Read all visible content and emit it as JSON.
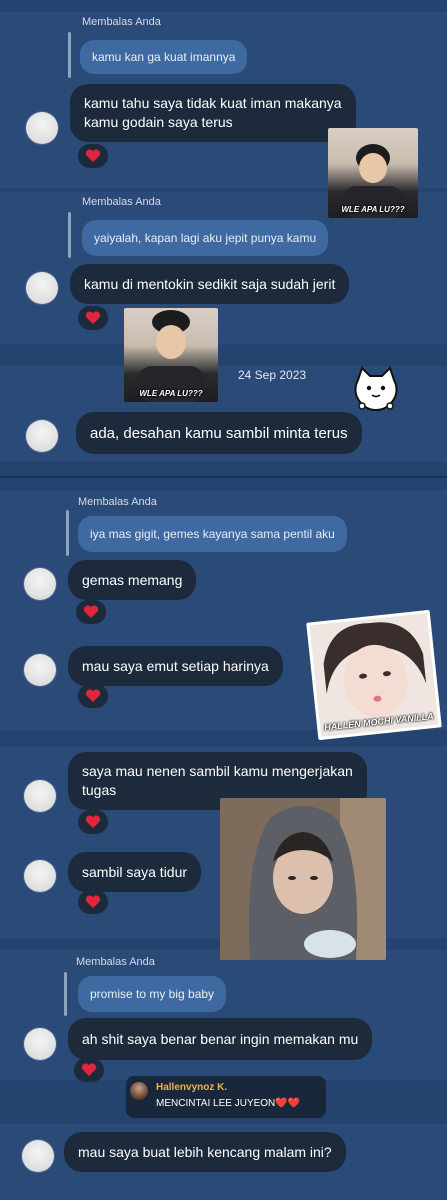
{
  "colors": {
    "background": "#24446f",
    "bubble": "#1c2a3b",
    "reply_bubble": "#3f6aa1",
    "heart": "#e0263c",
    "commenter_name": "#f0b24a"
  },
  "blocks": [
    {
      "reply_label": "Membalas Anda",
      "reply_text": "kamu kan ga kuat imannya",
      "message_line1": "kamu tahu saya tidak kuat iman makanya",
      "message_line2": "kamu godain saya terus",
      "reaction": "heart-icon"
    },
    {
      "reply_label": "Membalas Anda",
      "reply_text": "yaiyalah, kapan lagi aku jepit punya kamu",
      "message": "kamu di mentokin sedikit saja sudah jerit",
      "reaction": "heart-icon"
    },
    {
      "date": "24 Sep 2023",
      "message": "ada, desahan kamu sambil minta terus"
    },
    {
      "reply_label": "Membalas Anda",
      "reply_text": "iya mas gigit, gemes kayanya sama pentil aku",
      "message": "gemas memang",
      "reaction": "heart-icon"
    },
    {
      "message": "mau saya emut setiap harinya",
      "reaction": "heart-icon"
    },
    {
      "message_line1": "saya mau nenen sambil kamu mengerjakan",
      "message_line2": "tugas",
      "reaction": "heart-icon"
    },
    {
      "message": "sambil saya tidur",
      "reaction": "heart-icon"
    },
    {
      "reply_label": "Membalas Anda",
      "reply_text": "promise to my big baby",
      "message": "ah shit saya benar benar ingin memakan mu",
      "reaction": "heart-icon"
    },
    {
      "message": "mau saya buat lebih kencang malam ini?"
    }
  ],
  "stickers": {
    "s1_caption": "WLE APA LU???",
    "s2_caption": "WLE APA LU???",
    "s3_caption": "HALLEN MOCHI VANILLA"
  },
  "comment": {
    "name": "Hallenvynoz K.",
    "text": "MENCINTAI LEE JUYEON",
    "emoji": "❤️❤️"
  }
}
